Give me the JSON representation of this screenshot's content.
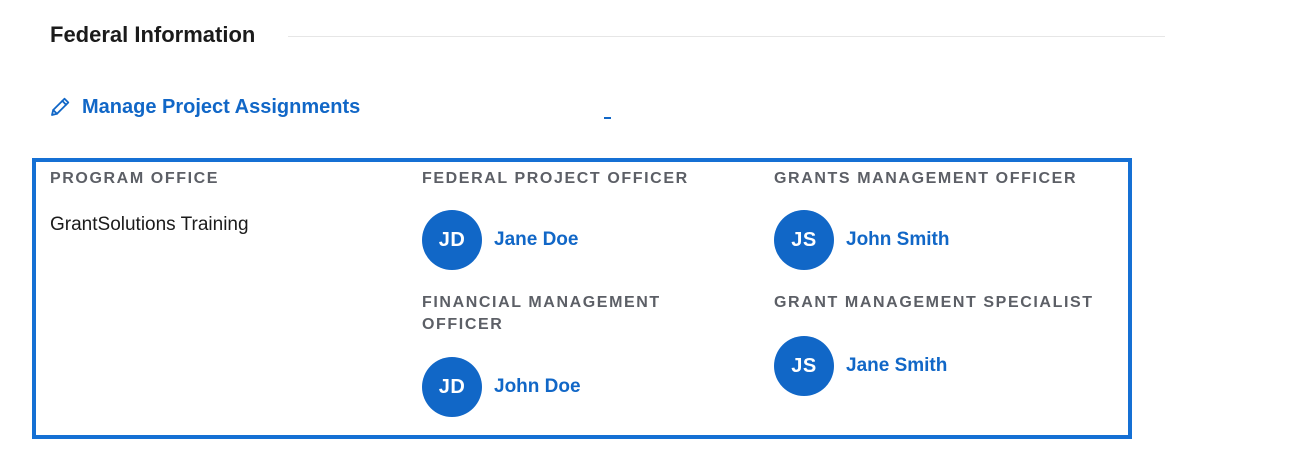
{
  "section": {
    "title": "Federal Information"
  },
  "manage_link": {
    "label": "Manage Project Assignments",
    "icon": "pencil-icon"
  },
  "program_office": {
    "heading": "PROGRAM OFFICE",
    "value": "GrantSolutions Training"
  },
  "federal_project_officer": {
    "heading": "FEDERAL PROJECT OFFICER",
    "initials": "JD",
    "name": "Jane Doe"
  },
  "grants_management_officer": {
    "heading": "GRANTS MANAGEMENT OFFICER",
    "initials": "JS",
    "name": "John Smith"
  },
  "financial_management_officer": {
    "heading_line1": "FINANCIAL MANAGEMENT",
    "heading_line2": "OFFICER",
    "initials": "JD",
    "name": "John Doe"
  },
  "grant_management_specialist": {
    "heading": "GRANT MANAGEMENT SPECIALIST",
    "initials": "JS",
    "name": "Jane Smith"
  },
  "colors": {
    "accent": "#1167c7",
    "focus_border": "#1570d4",
    "heading_gray": "#5c5f66"
  }
}
